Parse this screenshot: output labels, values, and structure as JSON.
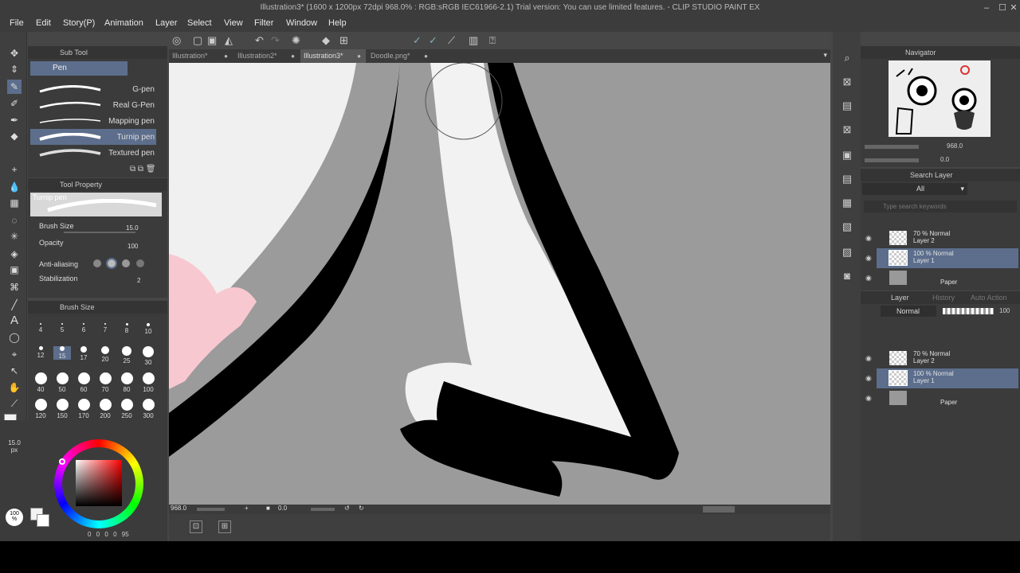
{
  "title": "Illustration3* (1600 x 1200px 72dpi 968.0% : RGB:sRGB IEC61966-2.1)  Trial version: You can use limited features. - CLIP STUDIO PAINT EX",
  "window_controls": [
    "–",
    "☐",
    "✕"
  ],
  "menu": [
    "File",
    "Edit",
    "Story(P)",
    "Animation",
    "Layer",
    "Select",
    "View",
    "Filter",
    "Window",
    "Help"
  ],
  "tabs": [
    {
      "label": "Illustration*",
      "active": false
    },
    {
      "label": "Illustration2*",
      "active": false
    },
    {
      "label": "Illustration3*",
      "active": true
    },
    {
      "label": "Doodle.png*",
      "active": false
    }
  ],
  "subtool": {
    "header": "Sub Tool",
    "group": "Pen",
    "brushes": [
      {
        "label": "G-pen",
        "selected": false
      },
      {
        "label": "Real G-Pen",
        "selected": false
      },
      {
        "label": "Mapping pen",
        "selected": false
      },
      {
        "label": "Turnip pen",
        "selected": true
      },
      {
        "label": "Textured pen",
        "selected": false
      }
    ]
  },
  "tool_property": {
    "header": "Tool Property",
    "preview_label": "Turnip pen",
    "brush_size_label": "Brush Size",
    "brush_size_value": "15.0",
    "opacity_label": "Opacity",
    "opacity_value": "100",
    "anti_aliasing_label": "Anti-aliasing",
    "stabilization_label": "Stabilization",
    "stabilization_value": "2"
  },
  "brush_size": {
    "header": "Brush Size",
    "sizes": [
      "4",
      "5",
      "6",
      "7",
      "8",
      "10",
      "12",
      "15",
      "17",
      "20",
      "25",
      "30",
      "40",
      "50",
      "60",
      "70",
      "80",
      "100",
      "120",
      "150",
      "170",
      "200",
      "250",
      "300"
    ],
    "selected": "15"
  },
  "color_panel": {
    "size_readout": "15.0",
    "size_unit": "px",
    "opacity_readout": "100",
    "opacity_unit": "%",
    "values": [
      "0",
      "0",
      "0",
      "0",
      "95"
    ],
    "fg_color": "#f2f2f2"
  },
  "status": {
    "zoom": "968.0",
    "angle": "0.0"
  },
  "navigator": {
    "header": "Navigator",
    "zoom": "968.0",
    "angle": "0.0"
  },
  "search_layer": {
    "header": "Search Layer",
    "filter": "All",
    "placeholder": "Type search keywords",
    "layers": [
      {
        "mode": "70 % Normal",
        "name": "Layer 2",
        "selected": false
      },
      {
        "mode": "100 % Normal",
        "name": "Layer 1",
        "selected": true
      },
      {
        "mode": "",
        "name": "Paper",
        "selected": false
      }
    ]
  },
  "layer_panel": {
    "tabs": [
      "Layer",
      "History",
      "Auto Action"
    ],
    "blend_mode": "Normal",
    "opacity": "100",
    "layers": [
      {
        "mode": "70 % Normal",
        "name": "Layer 2",
        "selected": false
      },
      {
        "mode": "100 % Normal",
        "name": "Layer 1",
        "selected": true
      },
      {
        "mode": "",
        "name": "Paper",
        "selected": false
      }
    ]
  },
  "colors": {
    "canvas_bg": "#9b9b9b",
    "selection": "#5c6e8c",
    "panel": "#3b3b3b"
  }
}
